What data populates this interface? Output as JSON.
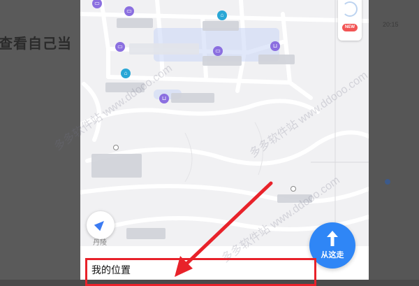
{
  "background": {
    "article_text": "查看自己当",
    "right_time": "20:15"
  },
  "map": {
    "labels_hidden": true,
    "poi_icons": [
      "hotel-icon",
      "hotel-icon",
      "hotel-icon",
      "hotel-icon",
      "shop-icon",
      "shop-icon",
      "shop-icon",
      "bank-icon",
      "bank-icon"
    ],
    "road_label": "丹陵"
  },
  "controls": {
    "new_badge": "NEW",
    "go_button_label": "从这走"
  },
  "sheet": {
    "title": "我的位置"
  },
  "watermark": "多多软件站 www.ddooo.com",
  "colors": {
    "accent_blue": "#2f86f6",
    "annotation_red": "#e8222a",
    "poi_purple": "#8b6fe0",
    "poi_teal": "#2aa7d6"
  }
}
